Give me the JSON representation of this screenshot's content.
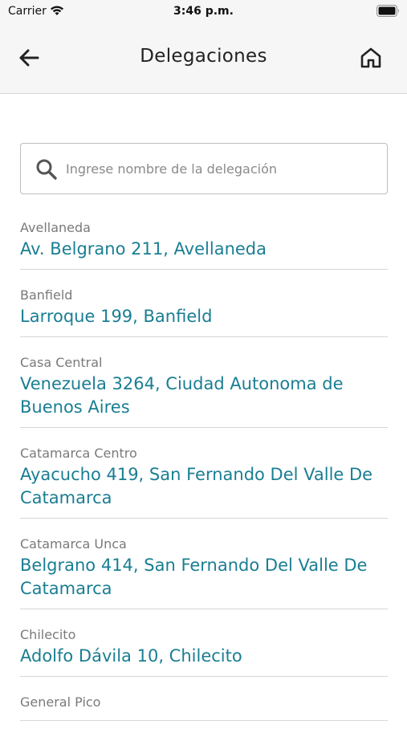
{
  "status_bar": {
    "carrier": "Carrier",
    "time": "3:46 p.m.",
    "icons": [
      "wifi-icon",
      "battery-icon"
    ]
  },
  "nav": {
    "title": "Delegaciones",
    "back_icon": "arrow-left-icon",
    "home_icon": "home-icon"
  },
  "search": {
    "placeholder": "Ingrese nombre de la delegación",
    "value": "",
    "icon": "search-icon"
  },
  "colors": {
    "address": "#1a7e93",
    "name": "#7a7a7a",
    "nav_background": "#f6f6f6"
  },
  "delegaciones": [
    {
      "name": "Avellaneda",
      "address": "Av. Belgrano 211, Avellaneda"
    },
    {
      "name": "Banfield",
      "address": "Larroque 199, Banfield"
    },
    {
      "name": "Casa Central",
      "address": "Venezuela 3264, Ciudad Autonoma de Buenos Aires"
    },
    {
      "name": "Catamarca Centro",
      "address": "Ayacucho 419, San Fernando Del Valle De Catamarca"
    },
    {
      "name": "Catamarca Unca",
      "address": "Belgrano 414, San Fernando Del Valle De Catamarca"
    },
    {
      "name": "Chilecito",
      "address": "Adolfo Dávila 10, Chilecito"
    },
    {
      "name": "General Pico",
      "address": ""
    }
  ]
}
